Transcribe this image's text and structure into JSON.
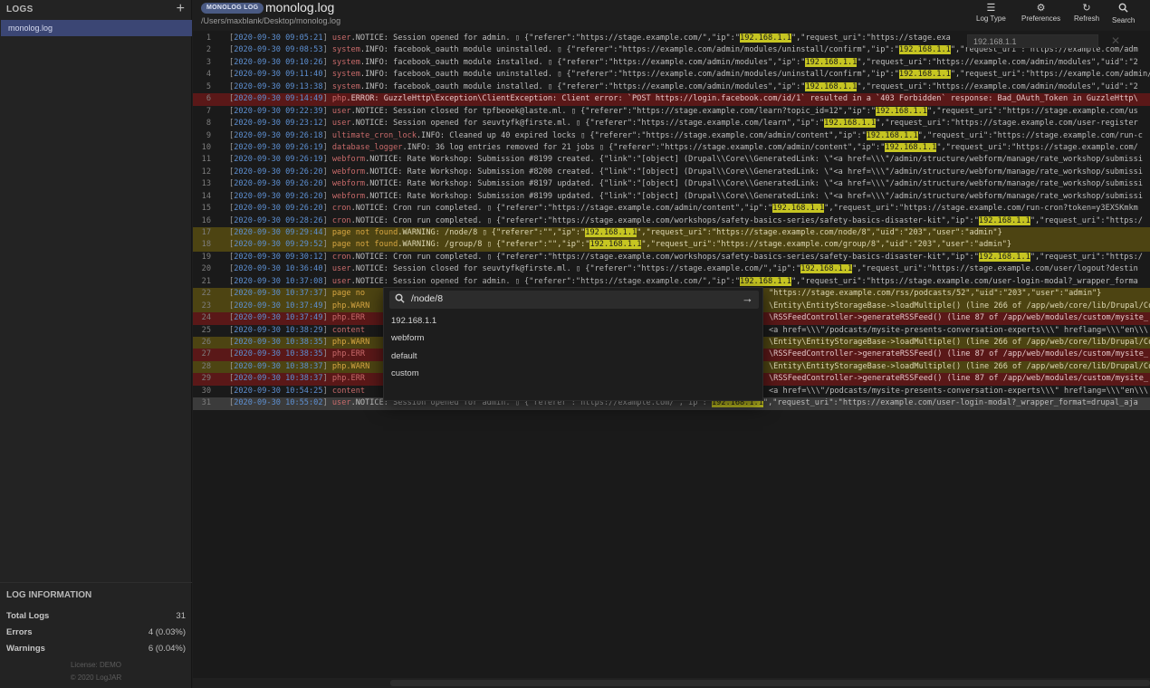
{
  "sidebar": {
    "title": "LOGS",
    "add_icon": "plus-icon",
    "files": [
      {
        "label": "monolog.log"
      }
    ],
    "info": {
      "title": "LOG INFORMATION",
      "rows": [
        {
          "label": "Total Logs",
          "value": "31"
        },
        {
          "label": "Errors",
          "value": "4 (0.03%)"
        },
        {
          "label": "Warnings",
          "value": "6 (0.04%)"
        }
      ]
    },
    "footer": {
      "license": "License: DEMO",
      "copyright": "© 2020 LogJAR"
    }
  },
  "header": {
    "badge": "MONOLOG LOG",
    "title": "monolog.log",
    "path": "/Users/maxblank/Desktop/monolog.log",
    "tools": [
      {
        "label": "Log Type",
        "icon": "menu-lines-icon"
      },
      {
        "label": "Preferences",
        "icon": "gears-icon"
      },
      {
        "label": "Refresh",
        "icon": "refresh-icon"
      },
      {
        "label": "Search",
        "icon": "search-icon"
      }
    ]
  },
  "filter": {
    "value": "192.168.1.1",
    "clear_icon": "close-icon"
  },
  "colors": {
    "highlight": "#c6c522",
    "error_row": "#5a1818",
    "warning_row": "#4d4412",
    "timestamp": "#5d8fd1",
    "badge": "#4a5a83",
    "selected_file": "#3b4674"
  },
  "lines": [
    {
      "n": "1",
      "ts": "2020-09-30 09:05:21",
      "chan": "user",
      "lvl": ".NOTICE:",
      "msg": " Session opened for admin. ▯ {\"referer\":\"https://stage.example.com/\",\"ip\":\"",
      "hl": "192.168.1.1",
      "rest": "\",\"request_uri\":\"https://stage.exa",
      "type": "normal"
    },
    {
      "n": "2",
      "ts": "2020-09-30 09:08:53",
      "chan": "system",
      "lvl": ".INFO:",
      "msg": " facebook_oauth module uninstalled. ▯ {\"referer\":\"https://example.com/admin/modules/uninstall/confirm\",\"ip\":\"",
      "hl": "192.168.1.1",
      "rest": "\",\"request_uri\":\"https://example.com/adm",
      "type": "normal"
    },
    {
      "n": "3",
      "ts": "2020-09-30 09:10:26",
      "chan": "system",
      "lvl": ".INFO:",
      "msg": " facebook_oauth module installed. ▯ {\"referer\":\"https://example.com/admin/modules\",\"ip\":\"",
      "hl": "192.168.1.1",
      "rest": "\",\"request_uri\":\"https://example.com/admin/modules\",\"uid\":\"2",
      "type": "normal"
    },
    {
      "n": "4",
      "ts": "2020-09-30 09:11:40",
      "chan": "system",
      "lvl": ".INFO:",
      "msg": " facebook_oauth module uninstalled. ▯ {\"referer\":\"https://example.com/admin/modules/uninstall/confirm\",\"ip\":\"",
      "hl": "192.168.1.1",
      "rest": "\",\"request_uri\":\"https://example.com/admin/modules/",
      "type": "normal"
    },
    {
      "n": "5",
      "ts": "2020-09-30 09:13:38",
      "chan": "system",
      "lvl": ".INFO:",
      "msg": " facebook_oauth module installed. ▯ {\"referer\":\"https://example.com/admin/modules\",\"ip\":\"",
      "hl": "192.168.1.1",
      "rest": "\",\"request_uri\":\"https://example.com/admin/modules\",\"uid\":\"2",
      "type": "normal"
    },
    {
      "n": "6",
      "ts": "2020-09-30 09:14:49",
      "chan": "php",
      "lvl": ".ERROR:",
      "msg": " GuzzleHttp\\Exception\\ClientException: Client error: `POST https://login.facebook.com/id/1` resulted in a `403 Forbidden` response: Bad_OAuth_Token  in GuzzleHttp\\",
      "hl": "",
      "rest": "",
      "type": "err"
    },
    {
      "n": "7",
      "ts": "2020-09-30 09:22:39",
      "chan": "user",
      "lvl": ".NOTICE:",
      "msg": " Session closed for tpfbeoek@laste.ml. ▯ {\"referer\":\"https://stage.example.com/learn?topic_id=12\",\"ip\":\"",
      "hl": "192.168.1.1",
      "rest": "\",\"request_uri\":\"https://stage.example.com/us",
      "type": "normal"
    },
    {
      "n": "8",
      "ts": "2020-09-30 09:23:12",
      "chan": "user",
      "lvl": ".NOTICE:",
      "msg": " Session opened for seuvtyfk@firste.ml. ▯ {\"referer\":\"https://stage.example.com/learn\",\"ip\":\"",
      "hl": "192.168.1.1",
      "rest": "\",\"request_uri\":\"https://stage.example.com/user-register",
      "type": "normal"
    },
    {
      "n": "9",
      "ts": "2020-09-30 09:26:18",
      "chan": "ultimate_cron_lock",
      "lvl": ".INFO:",
      "msg": " Cleaned up 40 expired locks ▯ {\"referer\":\"https://stage.example.com/admin/content\",\"ip\":\"",
      "hl": "192.168.1.1",
      "rest": "\",\"request_uri\":\"https://stage.example.com/run-c",
      "type": "normal"
    },
    {
      "n": "10",
      "ts": "2020-09-30 09:26:19",
      "chan": "database_logger",
      "lvl": ".INFO:",
      "msg": " 36 log entries removed for 21 jobs ▯ {\"referer\":\"https://stage.example.com/admin/content\",\"ip\":\"",
      "hl": "192.168.1.1",
      "rest": "\",\"request_uri\":\"https://stage.example.com/",
      "type": "normal"
    },
    {
      "n": "11",
      "ts": "2020-09-30 09:26:19",
      "chan": "webform",
      "lvl": ".NOTICE:",
      "msg": " Rate Workshop: Submission #8199 created. {\"link\":\"[object] (Drupal\\\\Core\\\\GeneratedLink: \\\"<a href=\\\\\\\"/admin/structure/webform/manage/rate_workshop/submissi",
      "hl": "",
      "rest": "",
      "type": "normal"
    },
    {
      "n": "12",
      "ts": "2020-09-30 09:26:20",
      "chan": "webform",
      "lvl": ".NOTICE:",
      "msg": " Rate Workshop: Submission #8200 created. {\"link\":\"[object] (Drupal\\\\Core\\\\GeneratedLink: \\\"<a href=\\\\\\\"/admin/structure/webform/manage/rate_workshop/submissi",
      "hl": "",
      "rest": "",
      "type": "normal"
    },
    {
      "n": "13",
      "ts": "2020-09-30 09:26:20",
      "chan": "webform",
      "lvl": ".NOTICE:",
      "msg": " Rate Workshop: Submission #8197 updated. {\"link\":\"[object] (Drupal\\\\Core\\\\GeneratedLink: \\\"<a href=\\\\\\\"/admin/structure/webform/manage/rate_workshop/submissi",
      "hl": "",
      "rest": "",
      "type": "normal"
    },
    {
      "n": "14",
      "ts": "2020-09-30 09:26:20",
      "chan": "webform",
      "lvl": ".NOTICE:",
      "msg": " Rate Workshop: Submission #8199 updated. {\"link\":\"[object] (Drupal\\\\Core\\\\GeneratedLink: \\\"<a href=\\\\\\\"/admin/structure/webform/manage/rate_workshop/submissi",
      "hl": "",
      "rest": "",
      "type": "normal"
    },
    {
      "n": "15",
      "ts": "2020-09-30 09:26:20",
      "chan": "cron",
      "lvl": ".NOTICE:",
      "msg": " Cron run completed. ▯ {\"referer\":\"https://stage.example.com/admin/content\",\"ip\":\"",
      "hl": "192.168.1.1",
      "rest": "\",\"request_uri\":\"https://stage.example.com/run-cron?token=y3EXSKmkm",
      "type": "normal"
    },
    {
      "n": "16",
      "ts": "2020-09-30 09:28:26",
      "chan": "cron",
      "lvl": ".NOTICE:",
      "msg": " Cron run completed. ▯ {\"referer\":\"https://stage.example.com/workshops/safety-basics-series/safety-basics-disaster-kit\",\"ip\":\"",
      "hl": "192.168.1.1",
      "rest": "\",\"request_uri\":\"https:/",
      "type": "normal"
    },
    {
      "n": "17",
      "ts": "2020-09-30 09:29:44",
      "chan": "page not found",
      "lvl": ".WARNING:",
      "msg": " /node/8 ▯ {\"referer\":\"\",\"ip\":\"",
      "hl": "192.168.1.1",
      "rest": "\",\"request_uri\":\"https://stage.example.com/node/8\",\"uid\":\"203\",\"user\":\"admin\"}",
      "type": "warn"
    },
    {
      "n": "18",
      "ts": "2020-09-30 09:29:52",
      "chan": "page not found",
      "lvl": ".WARNING:",
      "msg": " /group/8 ▯ {\"referer\":\"\",\"ip\":\"",
      "hl": "192.168.1.1",
      "rest": "\",\"request_uri\":\"https://stage.example.com/group/8\",\"uid\":\"203\",\"user\":\"admin\"}",
      "type": "warn"
    },
    {
      "n": "19",
      "ts": "2020-09-30 09:30:12",
      "chan": "cron",
      "lvl": ".NOTICE:",
      "msg": " Cron run completed. ▯ {\"referer\":\"https://stage.example.com/workshops/safety-basics-series/safety-basics-disaster-kit\",\"ip\":\"",
      "hl": "192.168.1.1",
      "rest": "\",\"request_uri\":\"https:/",
      "type": "normal"
    },
    {
      "n": "20",
      "ts": "2020-09-30 10:36:40",
      "chan": "user",
      "lvl": ".NOTICE:",
      "msg": " Session closed for seuvtyfk@firste.ml. ▯ {\"referer\":\"https://stage.example.com/\",\"ip\":\"",
      "hl": "192.168.1.1",
      "rest": "\",\"request_uri\":\"https://stage.example.com/user/logout?destin",
      "type": "normal"
    },
    {
      "n": "21",
      "ts": "2020-09-30 10:37:08",
      "chan": "user",
      "lvl": ".NOTICE:",
      "msg": " Session opened for admin. ▯ {\"referer\":\"https://stage.example.com/\",\"ip\":\"",
      "hl": "192.168.1.1",
      "rest": "\",\"request_uri\":\"https://stage.example.com/user-login-modal?_wrapper_forma",
      "type": "normal"
    },
    {
      "n": "22",
      "ts": "2020-09-30 10:37:37",
      "chan": "page no",
      "lvl": "",
      "msg": "",
      "hl": "",
      "rest": "",
      "tail": "\"https://stage.example.com/rss/podcasts/52\",\"uid\":\"203\",\"user\":\"admin\"}",
      "type": "warn"
    },
    {
      "n": "23",
      "ts": "2020-09-30 10:37:49",
      "chan": "php.WARN",
      "lvl": "",
      "msg": "",
      "hl": "",
      "rest": "",
      "tail": "\\Entity\\EntityStorageBase->loadMultiple() (line 266 of /app/web/core/lib/Drupal/Co",
      "type": "warn"
    },
    {
      "n": "24",
      "ts": "2020-09-30 10:37:49",
      "chan": "php.ERR",
      "lvl": "",
      "msg": "",
      "hl": "",
      "rest": "",
      "tail": "\\RSSFeedController->generateRSSFeed() (line 87 of /app/web/modules/custom/mysite_",
      "type": "err"
    },
    {
      "n": "25",
      "ts": "2020-09-30 10:38:29",
      "chan": "content",
      "lvl": "",
      "msg": "",
      "hl": "",
      "rest": "",
      "tail": "<a href=\\\\\\\"/podcasts/mysite-presents-conversation-experts\\\\\\\" hreflang=\\\\\\\"en\\\\\\",
      "type": "normal"
    },
    {
      "n": "26",
      "ts": "2020-09-30 10:38:35",
      "chan": "php.WARN",
      "lvl": "",
      "msg": "",
      "hl": "",
      "rest": "",
      "tail": "\\Entity\\EntityStorageBase->loadMultiple() (line 266 of /app/web/core/lib/Drupal/Co",
      "type": "warn"
    },
    {
      "n": "27",
      "ts": "2020-09-30 10:38:35",
      "chan": "php.ERR",
      "lvl": "",
      "msg": "",
      "hl": "",
      "rest": "",
      "tail": "\\RSSFeedController->generateRSSFeed() (line 87 of /app/web/modules/custom/mysite_",
      "type": "err"
    },
    {
      "n": "28",
      "ts": "2020-09-30 10:38:37",
      "chan": "php.WARN",
      "lvl": "",
      "msg": "",
      "hl": "",
      "rest": "",
      "tail": "\\Entity\\EntityStorageBase->loadMultiple() (line 266 of /app/web/core/lib/Drupal/Co",
      "type": "warn"
    },
    {
      "n": "29",
      "ts": "2020-09-30 10:38:37",
      "chan": "php.ERR",
      "lvl": "",
      "msg": "",
      "hl": "",
      "rest": "",
      "tail": "\\RSSFeedController->generateRSSFeed() (line 87 of /app/web/modules/custom/mysite_",
      "type": "err"
    },
    {
      "n": "30",
      "ts": "2020-09-30 10:54:25",
      "chan": "content",
      "lvl": "",
      "msg": "",
      "hl": "",
      "rest": "",
      "tail": "<a href=\\\\\\\"/podcasts/mysite-presents-conversation-experts\\\\\\\" hreflang=\\\\\\\"en\\\\\\",
      "type": "normal"
    },
    {
      "n": "31",
      "ts": "2020-09-30 10:55:02",
      "chan": "user",
      "lvl": ".NOTICE:",
      "msg": " Session opened for admin. ▯ {\"referer\":\"https://example.com/\",\"ip\":\"",
      "hl": "192.168.1.1",
      "rest": "\",\"request_uri\":\"https://example.com/user-login-modal?_wrapper_format=drupal_aja",
      "type": "sel"
    }
  ],
  "search_popup": {
    "query": "/node/8",
    "search_icon": "search-icon",
    "submit_icon": "arrow-right-icon",
    "suggestions": [
      "192.168.1.1",
      "webform",
      "default",
      "custom"
    ]
  }
}
